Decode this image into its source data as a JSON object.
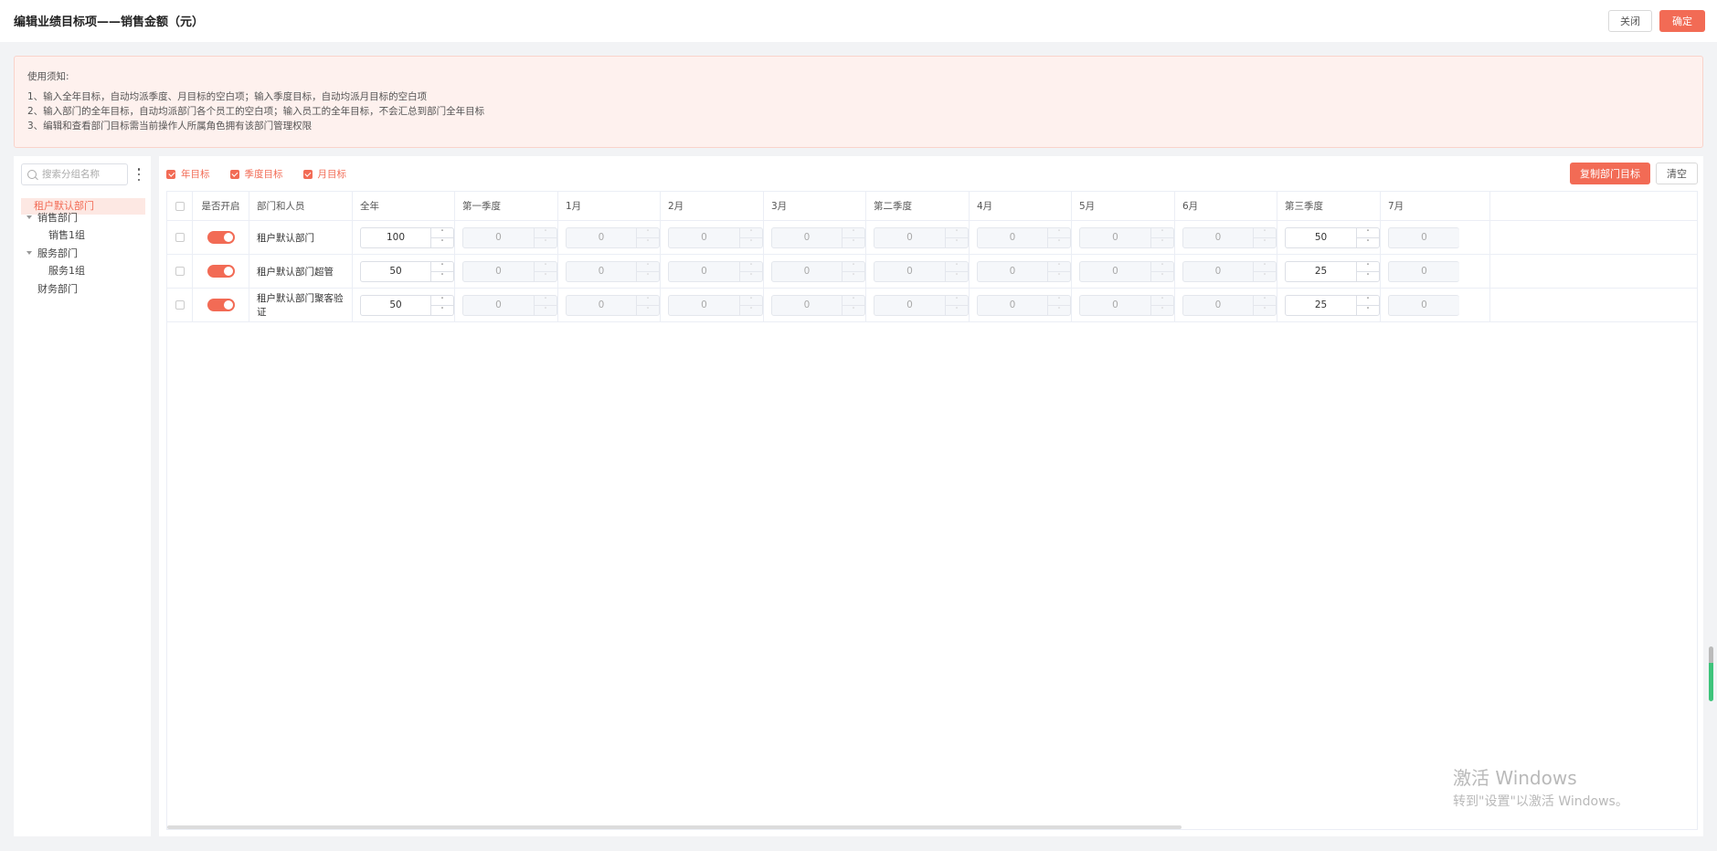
{
  "header": {
    "title": "编辑业绩目标项——销售金额（元）",
    "close_label": "关闭",
    "ok_label": "确定"
  },
  "notice": {
    "title": "使用须知:",
    "lines": [
      "1、输入全年目标，自动均派季度、月目标的空白项；输入季度目标，自动均派月目标的空白项",
      "2、输入部门的全年目标，自动均派部门各个员工的空白项；输入员工的全年目标，不会汇总到部门全年目标",
      "3、编辑和查看部门目标需当前操作人所属角色拥有该部门管理权限"
    ]
  },
  "sidebar": {
    "search_placeholder": "搜索分组名称",
    "tree": [
      {
        "label": "租户默认部门",
        "active": true
      },
      {
        "label": "销售部门",
        "expandable": true
      },
      {
        "label": "销售1组"
      },
      {
        "label": "服务部门",
        "expandable": true
      },
      {
        "label": "服务1组"
      },
      {
        "label": "财务部门"
      }
    ]
  },
  "toolbar": {
    "checks": [
      {
        "label": "年目标",
        "checked": true
      },
      {
        "label": "季度目标",
        "checked": true
      },
      {
        "label": "月目标",
        "checked": true
      }
    ],
    "copy_label": "复制部门目标",
    "clear_label": "清空"
  },
  "table": {
    "headers": [
      "是否开启",
      "部门和人员",
      "全年",
      "第一季度",
      "1月",
      "2月",
      "3月",
      "第二季度",
      "4月",
      "5月",
      "6月",
      "第三季度",
      "7月"
    ],
    "rows": [
      {
        "name": "租户默认部门",
        "enabled": true,
        "values": [
          "100",
          "0",
          "0",
          "0",
          "0",
          "0",
          "0",
          "0",
          "0",
          "50",
          "0"
        ]
      },
      {
        "name": "租户默认部门超管",
        "enabled": true,
        "values": [
          "50",
          "0",
          "0",
          "0",
          "0",
          "0",
          "0",
          "0",
          "0",
          "25",
          "0"
        ]
      },
      {
        "name": "租户默认部门聚客验证",
        "enabled": true,
        "values": [
          "50",
          "0",
          "0",
          "0",
          "0",
          "0",
          "0",
          "0",
          "0",
          "25",
          "0"
        ]
      }
    ]
  },
  "spinner": {
    "up": "˄",
    "down": "˅"
  },
  "watermark": {
    "line1": "激活 Windows",
    "line2": "转到\"设置\"以激活 Windows。"
  }
}
